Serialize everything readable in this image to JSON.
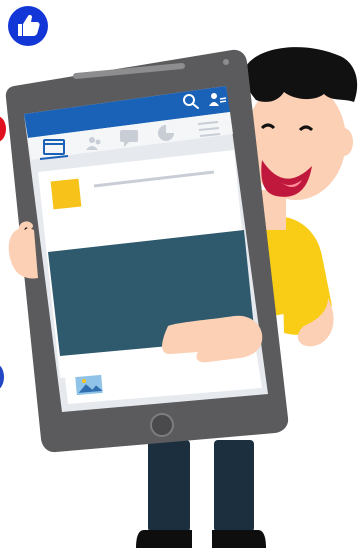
{
  "illustration": {
    "subject": "cartoon-person-holding-tablet",
    "icons": {
      "like": "thumbs-up-icon",
      "search": "search-icon",
      "profile": "profile-menu-icon",
      "tab_1": "browser-window-icon",
      "tab_2": "friends-icon",
      "tab_3": "chat-bubble-icon",
      "tab_4": "pie-chart-icon",
      "tab_5": "menu-lines-icon",
      "post_thumb": "image-thumbnail-icon"
    },
    "colors": {
      "brand_blue": "#1a62b8",
      "like_badge": "#1336d6",
      "tablet_frame": "#5b5b5d",
      "screen_bg": "#e6e9ee",
      "card_bg": "#ffffff",
      "post_image": "#2f5a6e",
      "avatar_yellow": "#f7c21a",
      "shirt_yellow": "#f9cd16",
      "skin": "#fcd0b4",
      "hair": "#111111",
      "pants": "#1b2f3e"
    }
  }
}
